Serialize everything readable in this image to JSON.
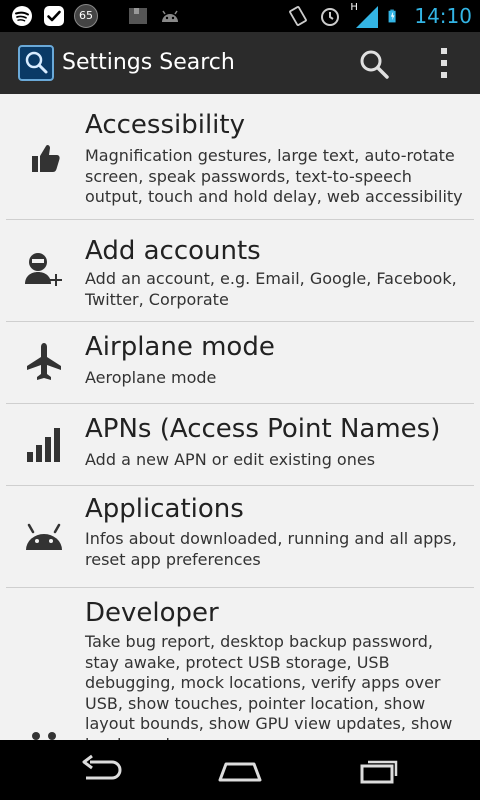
{
  "status_bar": {
    "time": "14:10",
    "notification_count": "65",
    "signal_label": "H",
    "left_icons": [
      "spotify-icon",
      "check-icon",
      "counter-icon",
      "image-icon",
      "android-icon"
    ],
    "right_icons": [
      "vibrate-icon",
      "alarm-icon",
      "signal-icon",
      "battery-icon"
    ]
  },
  "action_bar": {
    "title": "Settings Search",
    "accent_color": "#33b5e5"
  },
  "list": [
    {
      "title": "Accessibility",
      "subtitle": "Magnification gestures, large text, auto-rotate screen, speak passwords, text-to-speech output, touch and hold delay, web accessibility",
      "icon": "thumbs-up-icon"
    },
    {
      "title": "Add accounts",
      "subtitle": "Add an account, e.g. Email, Google, Facebook, Twitter, Corporate",
      "icon": "add-account-icon"
    },
    {
      "title": "Airplane mode",
      "subtitle": "Aeroplane mode",
      "icon": "airplane-icon"
    },
    {
      "title": "APNs (Access Point Names)",
      "subtitle": "Add a new APN or edit existing ones",
      "icon": "signal-bars-icon"
    },
    {
      "title": "Applications",
      "subtitle": "Infos about downloaded, running and all apps, reset app preferences",
      "icon": "android-icon"
    },
    {
      "title": "Developer",
      "subtitle": "Take bug report, desktop backup password, stay awake, protect USB storage, USB debugging, mock locations, verify apps over USB, show touches, pointer location, show layout bounds, show GPU view updates, show hardware layer",
      "icon": "developer-icon"
    }
  ]
}
